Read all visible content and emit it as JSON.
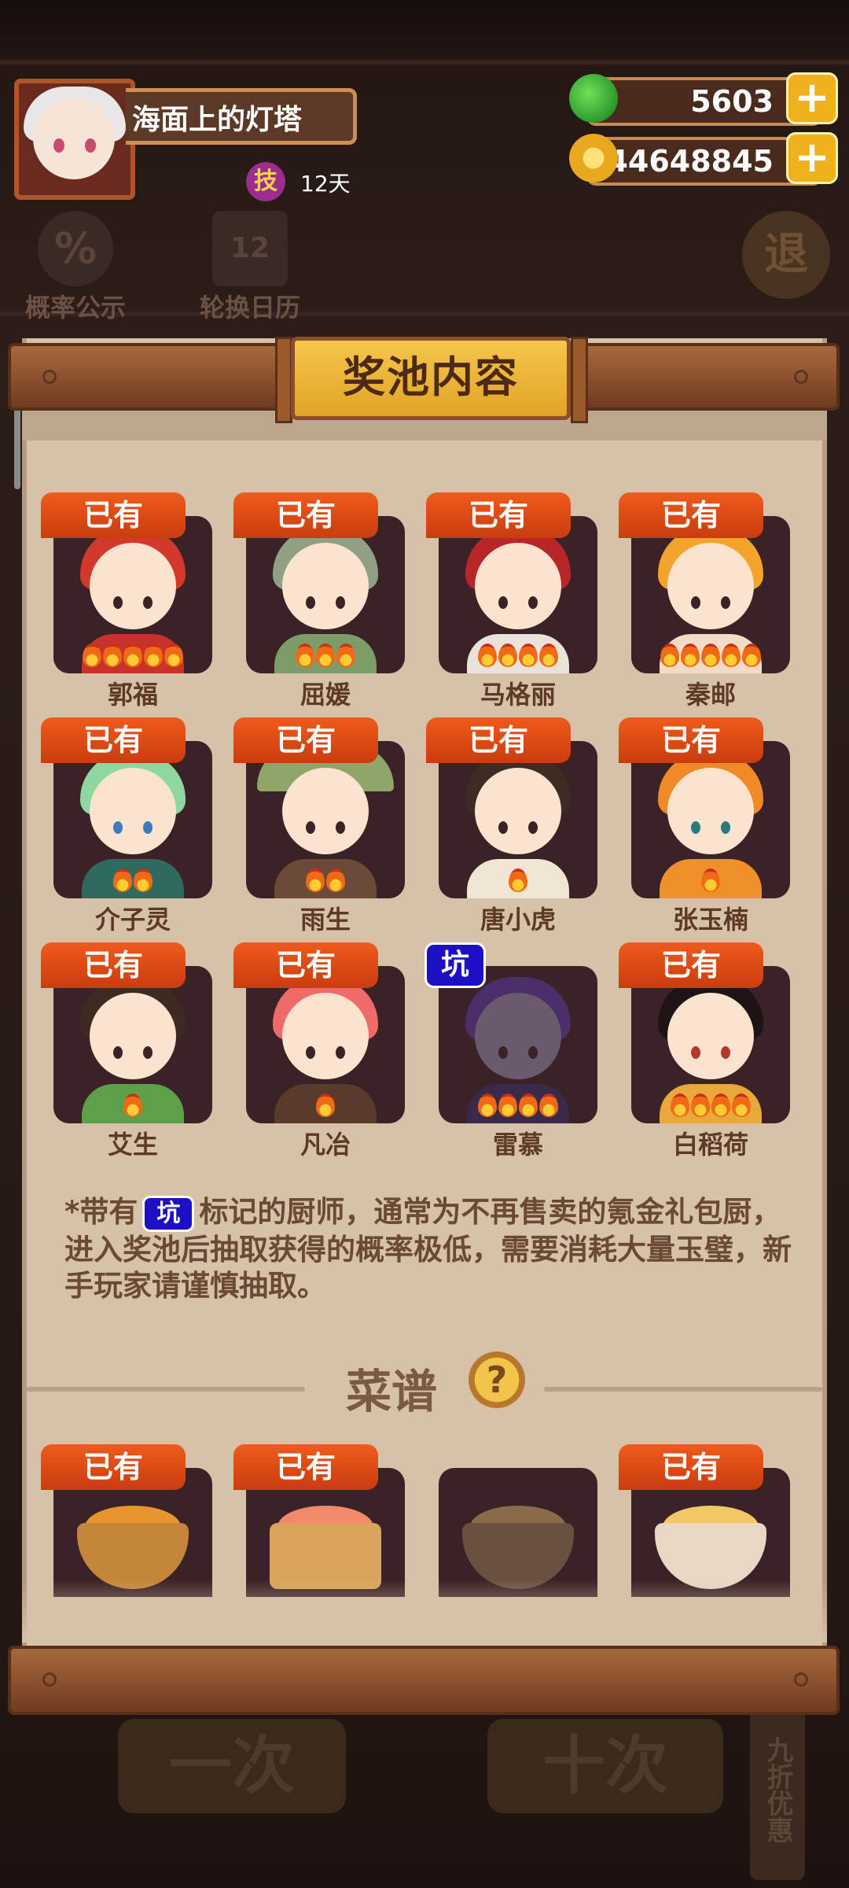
{
  "player": {
    "name": "海面上的灯塔",
    "skill_badge": "技",
    "skill_days": "12天"
  },
  "resources": {
    "jade": "5603",
    "coins": "44648845"
  },
  "background": {
    "probability_label": "概率公示",
    "calendar_label": "轮换日历",
    "calendar_num": "12",
    "exit_label": "退",
    "single_draw": "一次",
    "ten_draw": "十次",
    "discount": "九折优惠"
  },
  "modal": {
    "title": "奖池内容",
    "owned_label": "已有",
    "pit_label": "坑",
    "chefs": [
      {
        "name": "郭福",
        "badge": "已有"
      },
      {
        "name": "屈媛",
        "badge": "已有"
      },
      {
        "name": "马格丽",
        "badge": "已有"
      },
      {
        "name": "秦邮",
        "badge": "已有"
      },
      {
        "name": "介子灵",
        "badge": "已有"
      },
      {
        "name": "雨生",
        "badge": "已有"
      },
      {
        "name": "唐小虎",
        "badge": "已有"
      },
      {
        "name": "张玉楠",
        "badge": "已有"
      },
      {
        "name": "艾生",
        "badge": "已有"
      },
      {
        "name": "凡冶",
        "badge": "已有"
      },
      {
        "name": "雷慕",
        "badge": "坑"
      },
      {
        "name": "白稻荷",
        "badge": "已有"
      }
    ],
    "note_prefix": "*带有",
    "note_pit": "坑",
    "note_text": "标记的厨师，通常为不再售卖的氪金礼包厨，进入奖池后抽取获得的概率极低，需要消耗大量玉璧，新手玩家请谨慎抽取。",
    "recipe_title": "菜谱",
    "help_icon": "?",
    "recipes": [
      {
        "badge": "已有"
      },
      {
        "badge": "已有"
      },
      {
        "badge": ""
      },
      {
        "badge": "已有"
      }
    ]
  }
}
